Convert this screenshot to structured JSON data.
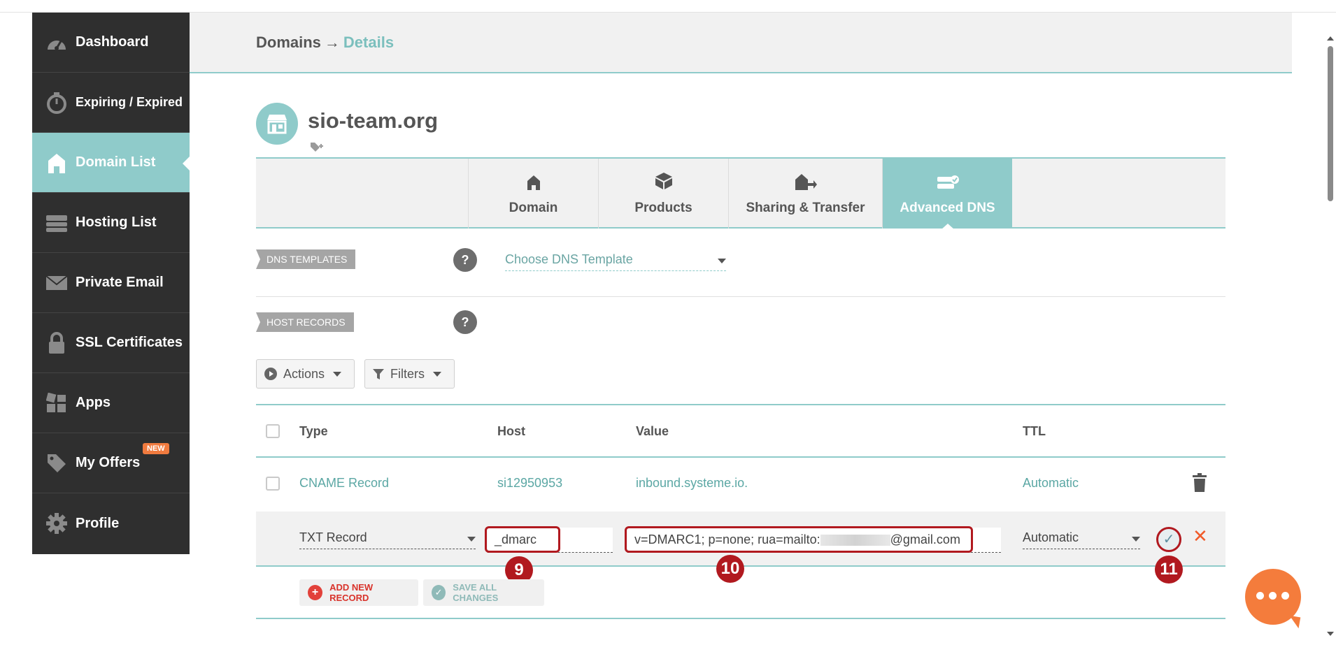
{
  "sidebar": {
    "items": [
      {
        "label": "Dashboard",
        "icon": "gauge-icon"
      },
      {
        "label": "Expiring / Expired",
        "icon": "stopwatch-icon"
      },
      {
        "label": "Domain List",
        "icon": "home-icon",
        "active": true
      },
      {
        "label": "Hosting List",
        "icon": "server-icon"
      },
      {
        "label": "Private Email",
        "icon": "envelope-icon"
      },
      {
        "label": "SSL Certificates",
        "icon": "lock-icon"
      },
      {
        "label": "Apps",
        "icon": "apps-icon"
      },
      {
        "label": "My Offers",
        "icon": "tag-icon",
        "badge": "NEW"
      },
      {
        "label": "Profile",
        "icon": "gear-icon"
      }
    ]
  },
  "header": {
    "breadcrumb_parent": "Domains",
    "breadcrumb_arrow": "→",
    "breadcrumb_current": "Details"
  },
  "domain": {
    "name": "sio-team.org"
  },
  "tabs": [
    {
      "label": "Domain",
      "icon": "home-icon"
    },
    {
      "label": "Products",
      "icon": "box-icon"
    },
    {
      "label": "Sharing & Transfer",
      "icon": "house-transfer-icon"
    },
    {
      "label": "Advanced DNS",
      "icon": "dns-server-icon",
      "active": true
    }
  ],
  "dns_templates": {
    "label": "DNS TEMPLATES",
    "help": "?",
    "select_value": "Choose DNS Template"
  },
  "host_records": {
    "label": "HOST RECORDS",
    "help": "?"
  },
  "controls": {
    "actions_label": "Actions",
    "filters_label": "Filters"
  },
  "table": {
    "columns": [
      "Type",
      "Host",
      "Value",
      "TTL"
    ],
    "rows": [
      {
        "type": "CNAME Record",
        "host": "si12950953",
        "value": "inbound.systeme.io.",
        "ttl": "Automatic"
      }
    ],
    "edit_row": {
      "type": "TXT Record",
      "host": "_dmarc",
      "value_prefix": "v=DMARC1; p=none; rua=mailto:",
      "value_suffix": "@gmail.com",
      "ttl": "Automatic"
    }
  },
  "footer_buttons": {
    "add_label": "ADD NEW RECORD",
    "save_label": "SAVE ALL CHANGES"
  },
  "annotations": {
    "marker_host": "9",
    "marker_value": "10",
    "marker_save": "11"
  },
  "colors": {
    "accent_teal": "#8fcbca",
    "sidebar_bg": "#2f2f2f",
    "highlight_red": "#b1191f",
    "chat_orange": "#f47c3c"
  }
}
